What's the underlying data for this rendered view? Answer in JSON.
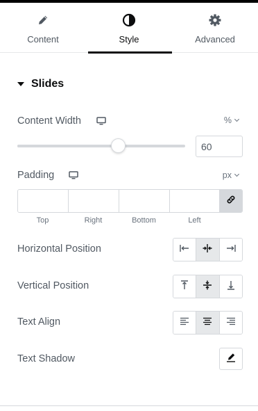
{
  "tabs": [
    {
      "label": "Content",
      "icon": "pencil-icon",
      "active": false
    },
    {
      "label": "Style",
      "icon": "half-circle-contrast-icon",
      "active": true
    },
    {
      "label": "Advanced",
      "icon": "gear-icon",
      "active": false
    }
  ],
  "section": {
    "title": "Slides",
    "expanded": true
  },
  "content_width": {
    "label": "Content Width",
    "unit": "%",
    "value": "60",
    "slider_fraction": 0.6
  },
  "padding": {
    "label": "Padding",
    "unit": "px",
    "fields": [
      "Top",
      "Right",
      "Bottom",
      "Left"
    ],
    "linked": true
  },
  "horizontal_position": {
    "label": "Horizontal Position",
    "options": [
      "align-left-icon",
      "align-center-icon",
      "align-right-icon"
    ],
    "selected": 1
  },
  "vertical_position": {
    "label": "Vertical Position",
    "options": [
      "align-top-icon",
      "align-middle-icon",
      "align-bottom-icon"
    ],
    "selected": 1
  },
  "text_align": {
    "label": "Text Align",
    "options": [
      "text-align-left-icon",
      "text-align-center-icon",
      "text-align-right-icon"
    ],
    "selected": 1
  },
  "text_shadow": {
    "label": "Text Shadow"
  },
  "colors": {
    "accent": "#0c0d0e",
    "text": "#515962",
    "muted": "#69727d",
    "border": "#d5d8dc",
    "selected_bg": "#e6e8ea"
  }
}
